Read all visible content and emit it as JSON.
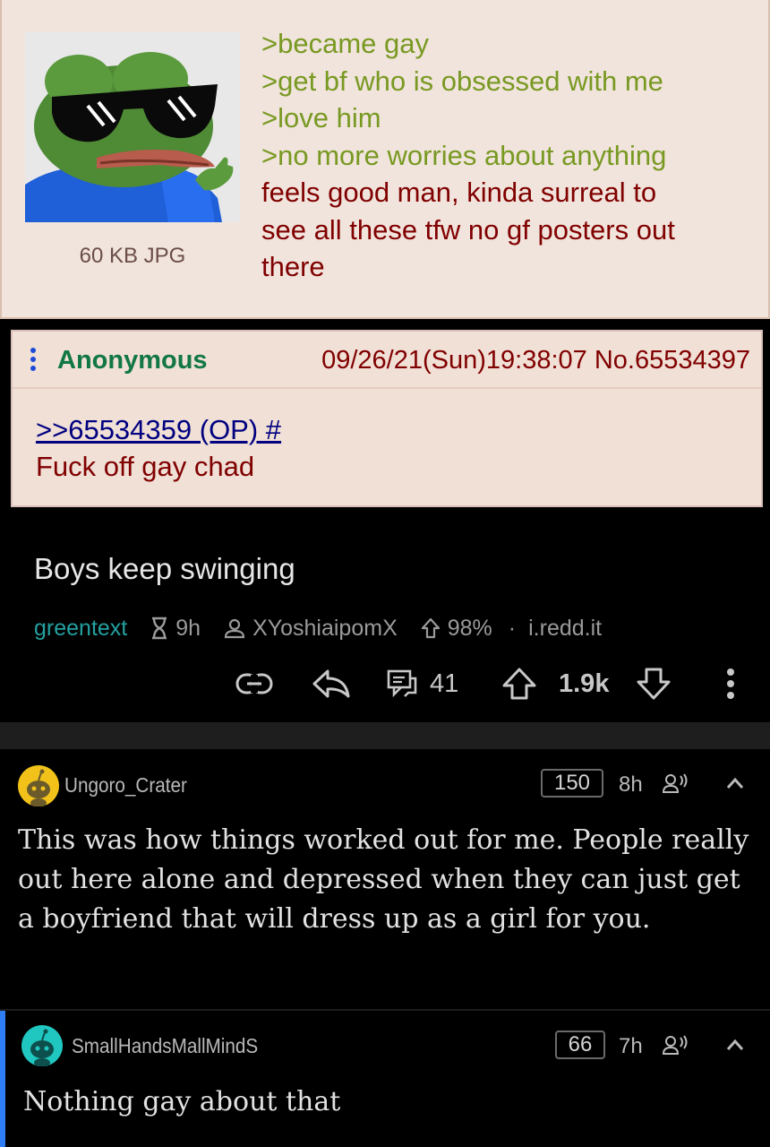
{
  "chan": {
    "file_info": "60 KB JPG",
    "op_lines": [
      {
        "text": ">became gay",
        "greentext": true
      },
      {
        "text": ">get bf who is obsessed with me",
        "greentext": true
      },
      {
        "text": ">love him",
        "greentext": true
      },
      {
        "text": ">no more worries about anything",
        "greentext": true
      },
      {
        "text": "feels good man, kinda surreal to",
        "greentext": false
      },
      {
        "text": "see all these tfw no gf posters out",
        "greentext": false
      },
      {
        "text": "there",
        "greentext": false
      }
    ],
    "reply": {
      "name": "Anonymous",
      "datetime": "09/26/21(Sun)19:38:07 No.65534397",
      "quote_link": ">>65534359 (OP) #",
      "body": "Fuck off gay chad"
    }
  },
  "reddit": {
    "post": {
      "title": "Boys keep swinging",
      "subreddit": "greentext",
      "age": "9h",
      "author": "XYoshiaipomX",
      "upvote_ratio": "98%",
      "separator": "·",
      "domain": "i.redd.it",
      "comment_count": "41",
      "score": "1.9k"
    },
    "comments": [
      {
        "user": "Ungoro_Crater",
        "score": "150",
        "age": "8h",
        "text": "This was how things worked out for me. People really out here alone and depressed when they can just get a boyfriend that will dress up as a girl for you.",
        "avatar_color": "#f2c21b"
      },
      {
        "user": "SmallHandsMallMindS",
        "score": "66",
        "age": "7h",
        "text": "Nothing gay about that",
        "avatar_color": "#20c7c0"
      }
    ]
  },
  "colors": {
    "greentext": "#789922",
    "chan_red": "#800000",
    "chan_name": "#117743",
    "reddit_sub": "#24a0a0",
    "thread_bar": "#2f7ef5"
  }
}
